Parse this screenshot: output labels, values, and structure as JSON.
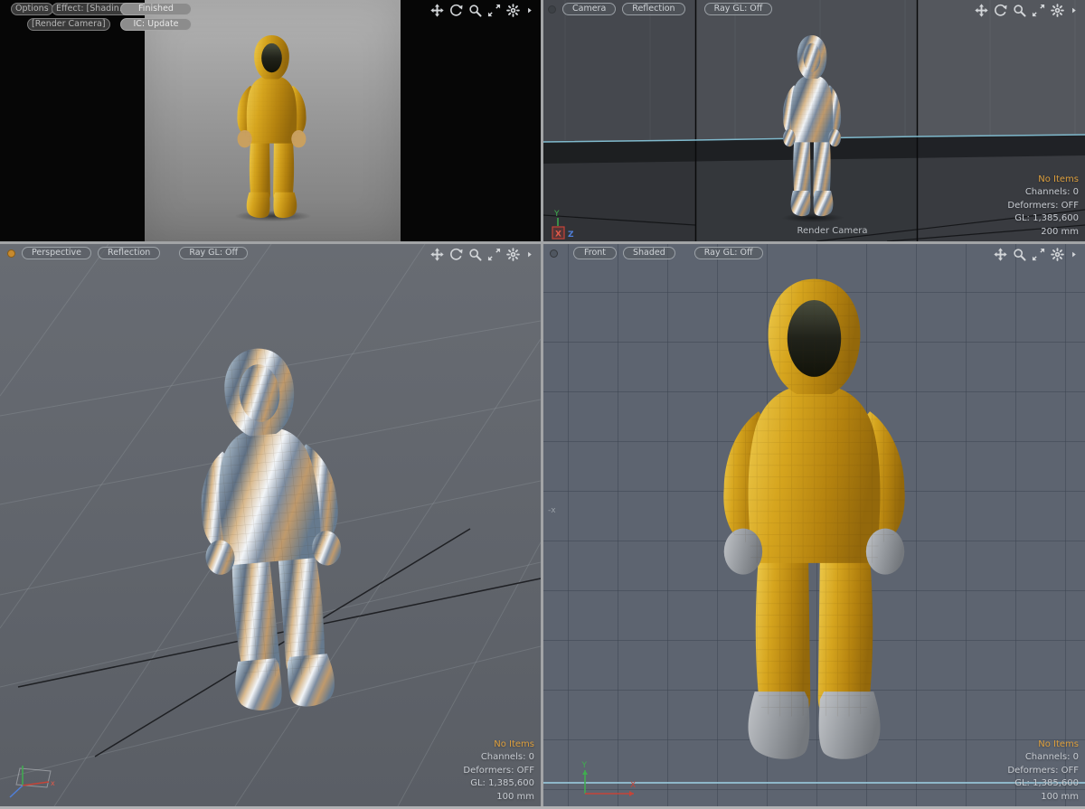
{
  "colors": {
    "accent_orange": "#dc9e3c",
    "horizon_cyan": "#7fb9cc",
    "suit_yellow": "#d2a11c",
    "front_bg": "#5d6470",
    "camera_bg": "#4c4f55",
    "render_bg_top": "#b4b4b4",
    "render_bg_bottom": "#7c7c7c"
  },
  "axis": {
    "x": "X",
    "y": "Y",
    "z": "Z",
    "x_lower": "x",
    "neg_x": "-x"
  },
  "icons": {
    "viewport_controls": [
      "pan-icon",
      "orbit-icon",
      "zoom-icon",
      "maximize-icon",
      "settings-gear-icon",
      "menu-arrow-icon"
    ]
  },
  "viewports": {
    "render": {
      "toolbar_row1": [
        "Options",
        "Effect: [Shadin...",
        "Finished"
      ],
      "toolbar_row2": [
        "[Render Camera]",
        "IC: Update"
      ]
    },
    "camera": {
      "toolbar": [
        "Camera",
        "Reflection",
        "Ray GL: Off"
      ],
      "camera_name": "Render Camera",
      "status": {
        "selection": "No Items",
        "channels": "Channels: 0",
        "deformers": "Deformers: OFF",
        "gl": "GL: 1,385,600",
        "grid_size": "200 mm"
      }
    },
    "perspective": {
      "toolbar": [
        "Perspective",
        "Reflection",
        "Ray GL: Off"
      ],
      "status": {
        "selection": "No Items",
        "channels": "Channels: 0",
        "deformers": "Deformers: OFF",
        "gl": "GL: 1,385,600",
        "grid_size": "100 mm"
      }
    },
    "front": {
      "toolbar": [
        "Front",
        "Shaded",
        "Ray GL: Off"
      ],
      "status": {
        "selection": "No Items",
        "channels": "Channels: 0",
        "deformers": "Deformers: OFF",
        "gl": "GL: 1,385,600",
        "grid_size": "100 mm"
      }
    }
  }
}
